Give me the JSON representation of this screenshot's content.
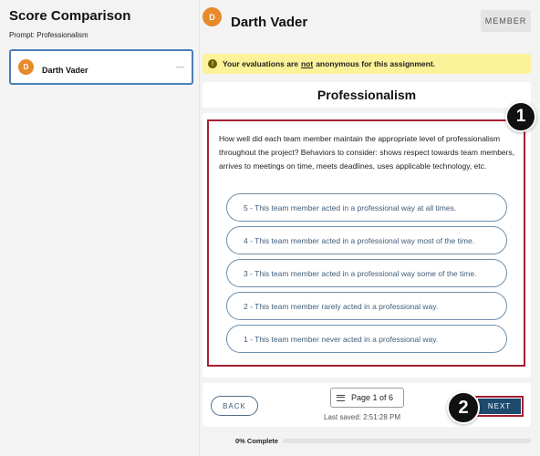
{
  "left_panel": {
    "title": "Score Comparison",
    "prompt": "Prompt: Professionalism",
    "member": {
      "initial": "D",
      "name": "Darth Vader",
      "dash": "—"
    }
  },
  "header": {
    "initial": "D",
    "name": "Darth Vader",
    "badge": "MEMBER"
  },
  "notice": {
    "icon": "!",
    "text_before": "Your evaluations are",
    "emphasis": "not",
    "text_after": "anonymous for this assignment."
  },
  "question": {
    "title": "Professionalism",
    "text": "How well did each team member maintain the appropriate level of professionalism throughout the project? Behaviors to consider: shows respect towards team members, arrives to meetings on time, meets deadlines, uses applicable technology, etc.",
    "options": [
      "5 - This team member acted in a professional way at all times.",
      "4 - This team member acted in a professional way most of the time.",
      "3 - This team member acted in a professional way some of the time.",
      "2 - This team member rarely acted in a professional way.",
      "1 - This team member never acted in a professional way."
    ]
  },
  "callouts": {
    "first": "1",
    "second": "2"
  },
  "footer": {
    "back": "BACK",
    "page": "Page 1 of 6",
    "last_saved": "Last saved: 2:51:28 PM",
    "next": "NEXT"
  },
  "progress": {
    "label": "0% Complete",
    "value_percent": 0
  },
  "colors": {
    "accent": "#1e4a6e",
    "highlight": "#a52032",
    "avatar": "#e8892a",
    "notice_bg": "#fbf29a"
  }
}
